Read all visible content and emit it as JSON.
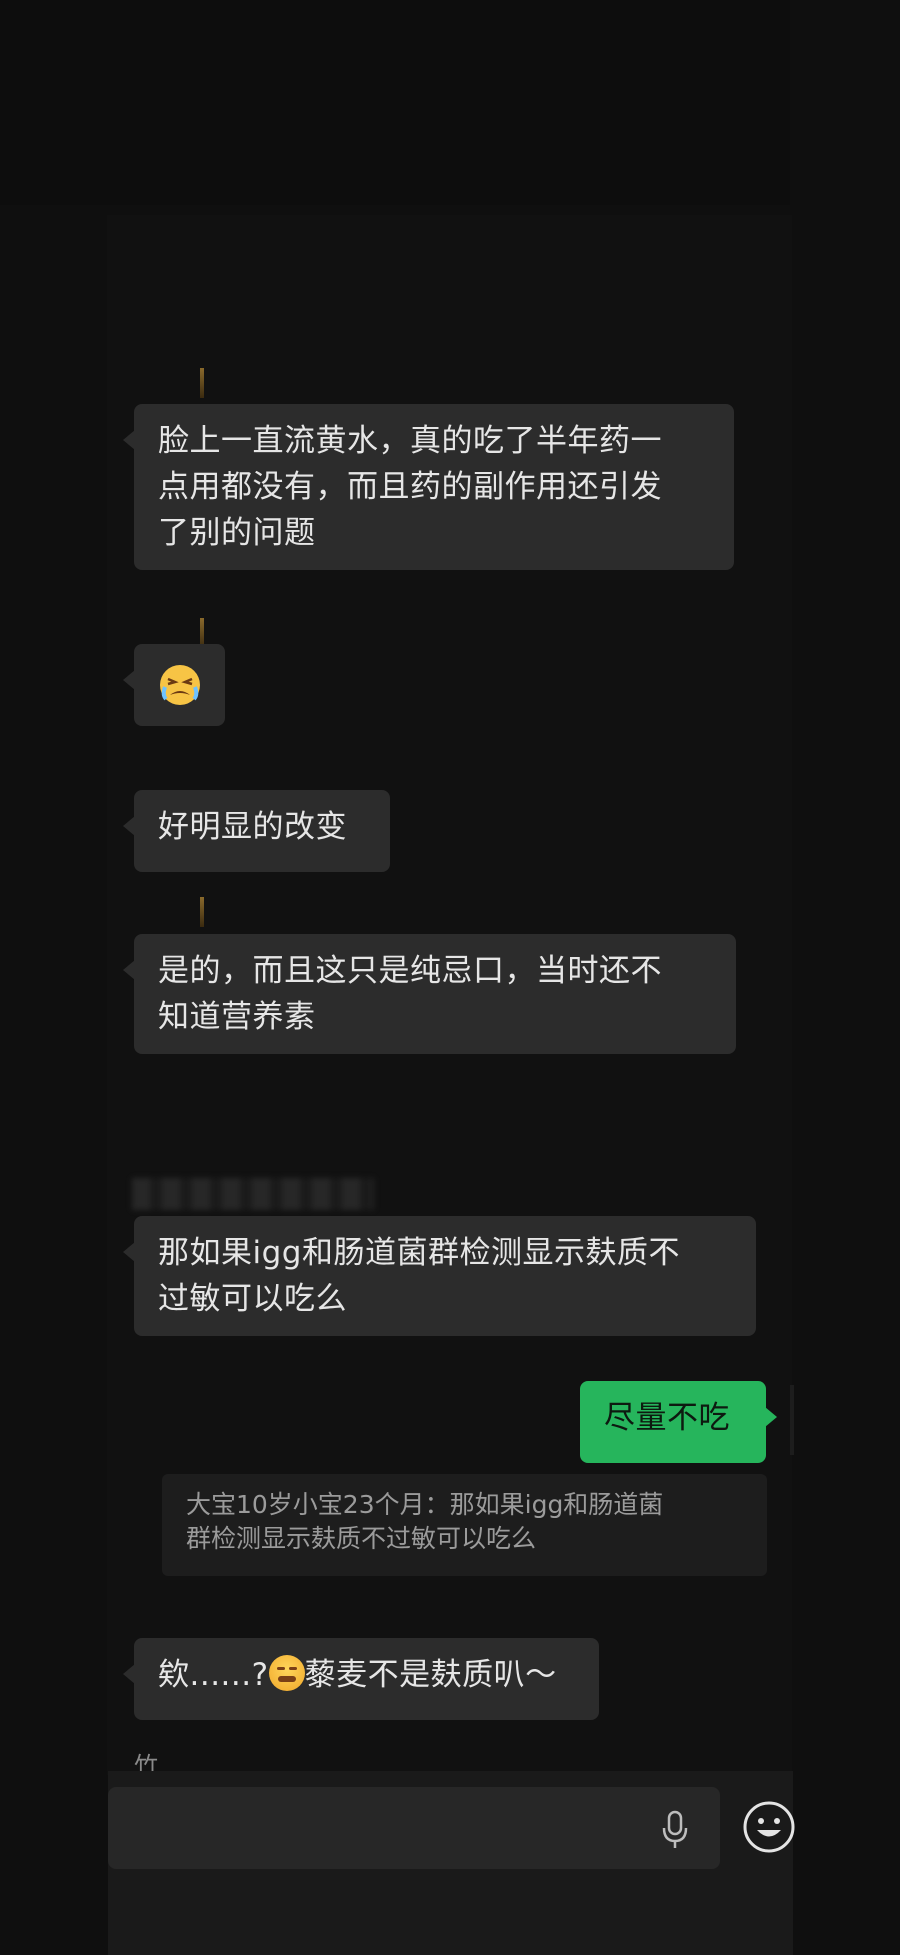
{
  "messages": [
    {
      "text": "脸上一直流黄水，真的吃了半年药一点用都没有，而且药的副作用还引发了别的问题",
      "line1": "脸上一直流黄水，真的吃了半年药一",
      "line2": "点用都没有，而且药的副作用还引发",
      "line3": "了别的问题"
    },
    {
      "emoji": "crying-face"
    },
    {
      "text": "好明显的改变"
    },
    {
      "line1": "是的，而且这只是纯忌口，当时还不",
      "line2": "知道营养素"
    },
    {
      "line1": "那如果igg和肠道菌群检测显示麸质不",
      "line2": "过敏可以吃么"
    },
    {
      "text": "尽量不吃"
    },
    {
      "text_before": "欸......?",
      "text_after": "藜麦不是麸质叭～"
    }
  ],
  "quote": {
    "line1": "大宝10岁小宝23个月：那如果igg和肠道菌",
    "line2": "群检测显示麸质不过敏可以吃么"
  },
  "cut_name": "竹",
  "colors": {
    "bubble_other": "#2c2c2c",
    "bubble_me": "#26b55c",
    "background": "#0f0f0f"
  },
  "icons": {
    "input_mic": "microphone-icon",
    "input_emoji": "smiley-icon"
  }
}
